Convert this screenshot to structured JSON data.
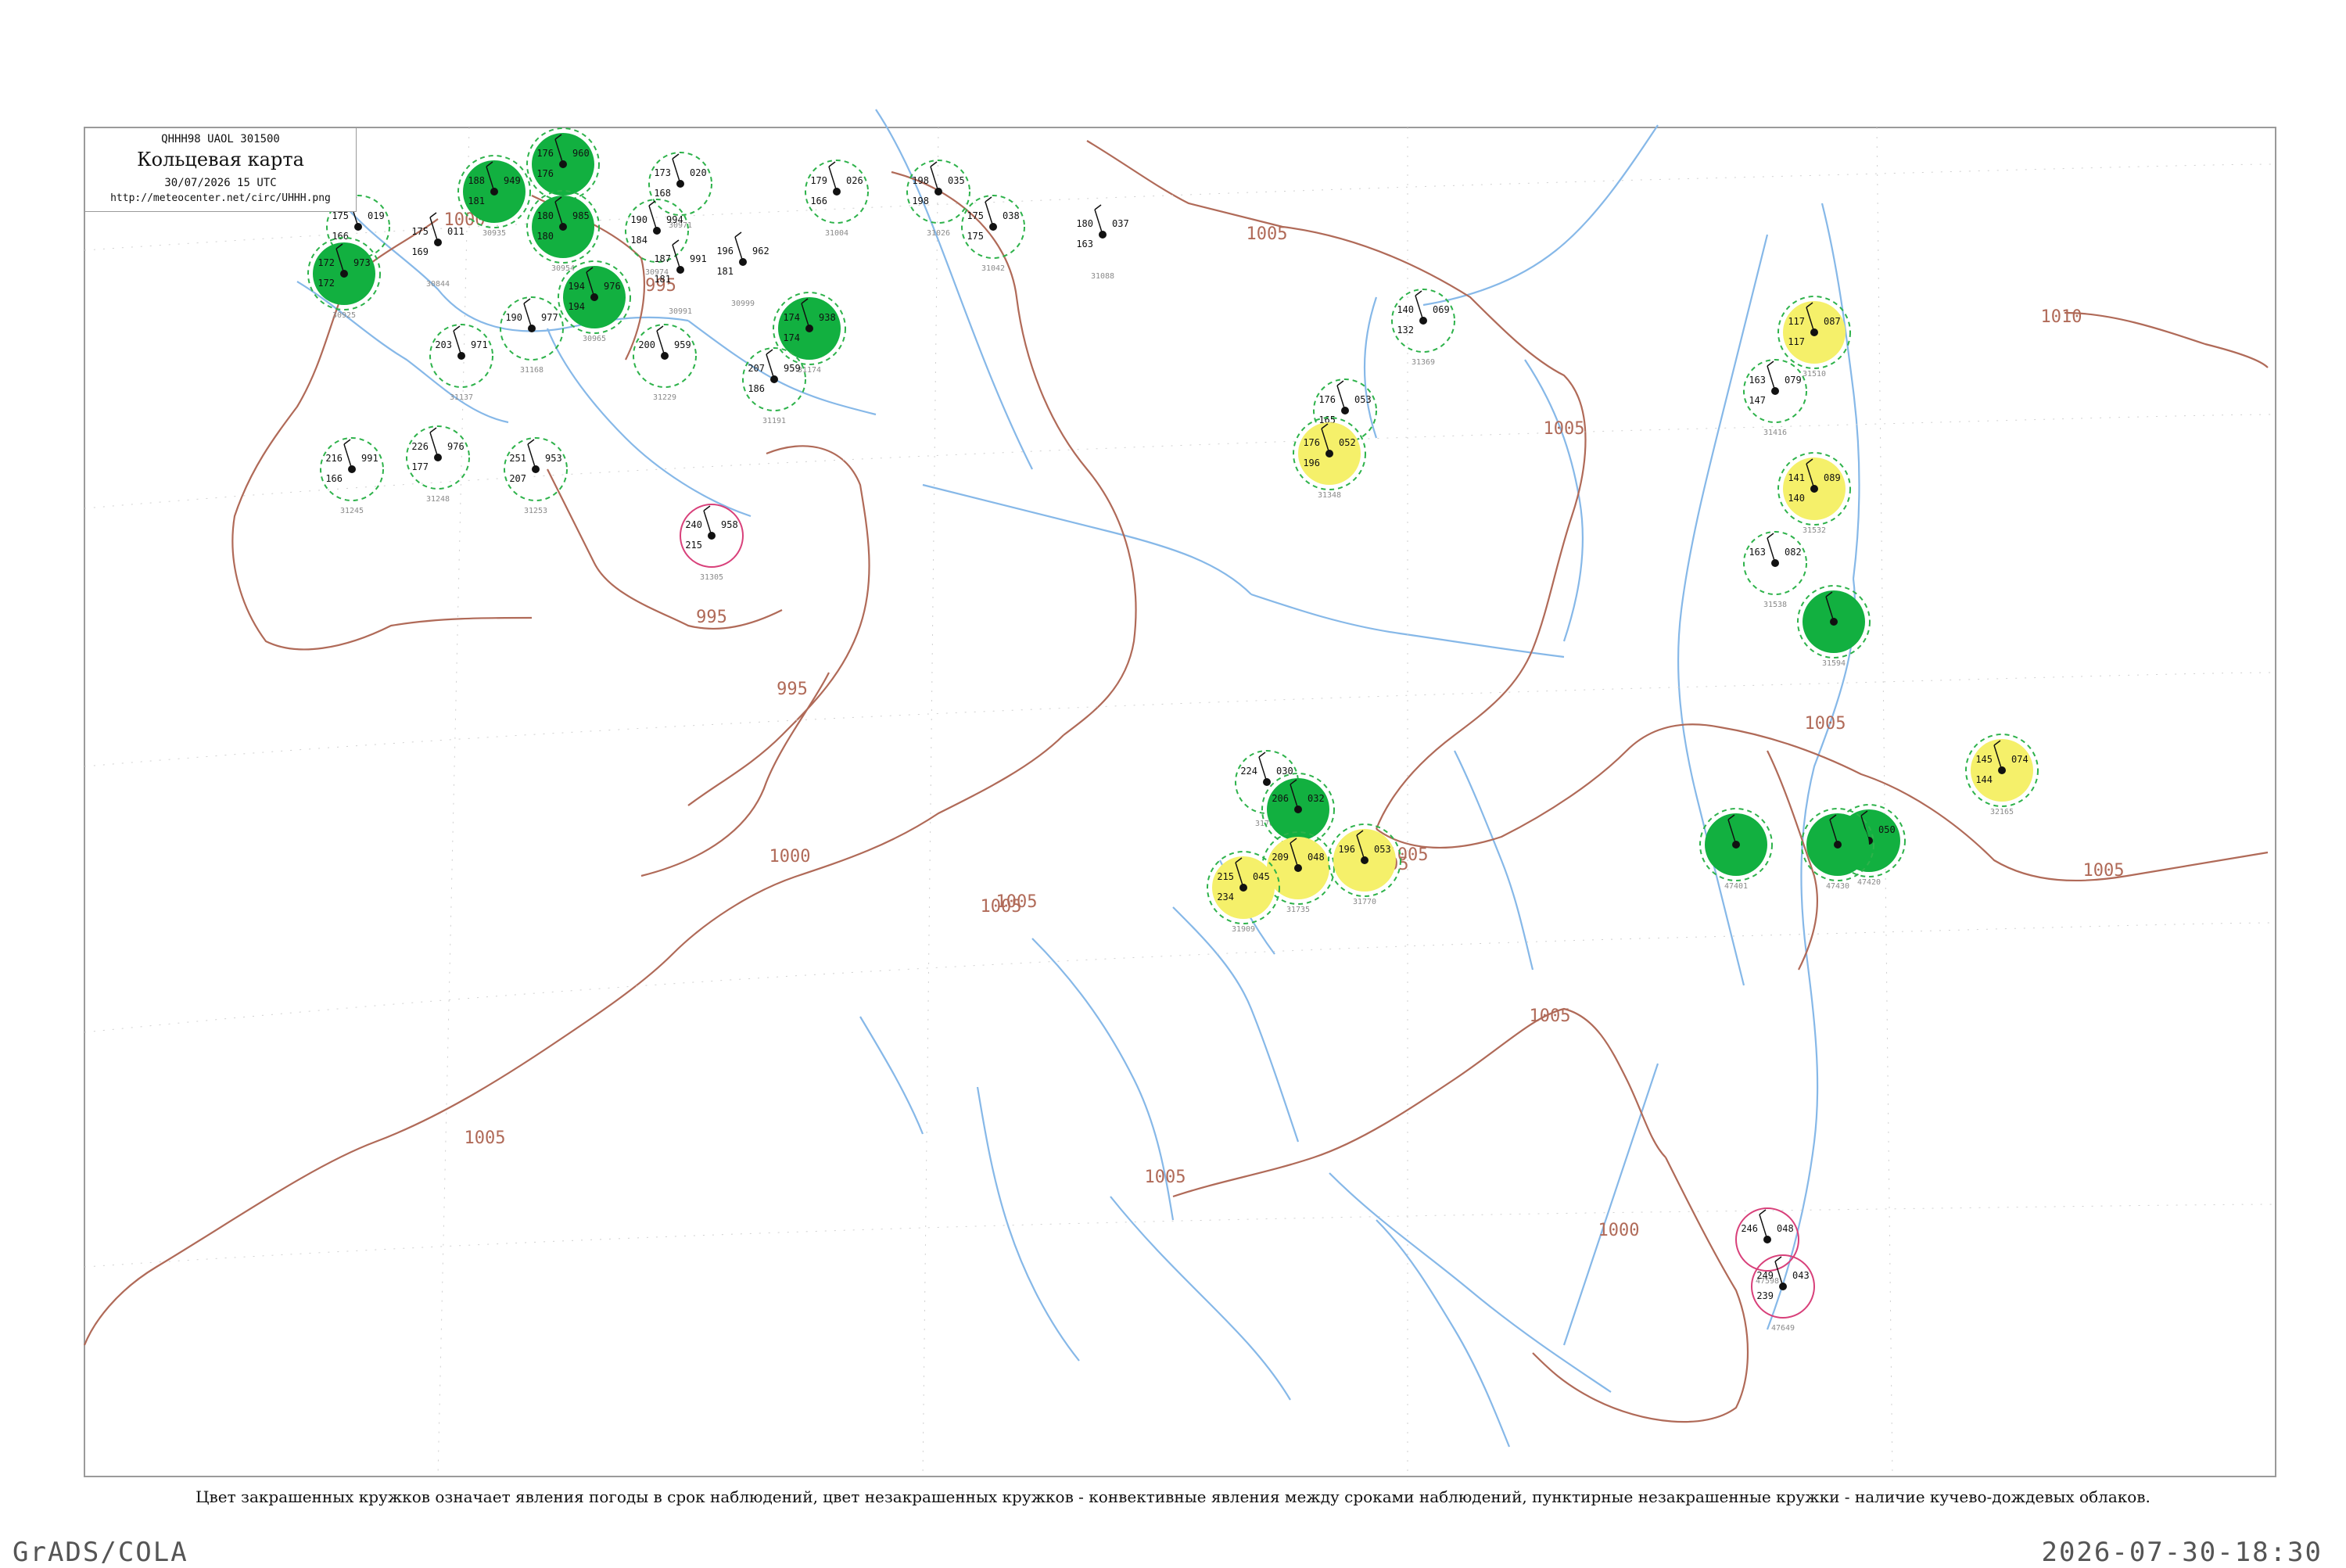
{
  "header": {
    "code": "QHHH98  UAOL  301500",
    "title": "Кольцевая карта",
    "datetime": "30/07/2026 15 UTC",
    "url": "http://meteocenter.net/circ/UHHH.png"
  },
  "caption": "Цвет закрашенных кружков означает явления погоды в срок наблюдений, цвет незакрашенных кружков - конвективные явления между сроками наблюдений, пунктирные незакрашенные кружки - наличие кучево-дождевых облаков.",
  "footer": {
    "left": "GrADS/COLA",
    "right": "2026-07-30-18:30"
  },
  "colors": {
    "isobar": "#b06a58",
    "river": "#86b8e8",
    "green_fill": "#12b040",
    "yellow_fill": "#f5f06a",
    "cb_dashed": "#2db24a",
    "convective_ring": "#d8407a",
    "text": "#111111",
    "index": "#8a8a8a"
  },
  "isobar_labels": [
    "1000",
    "995",
    "995",
    "995",
    "1000",
    "1005",
    "1005",
    "1005",
    "1005",
    "1005",
    "1005",
    "1005",
    "1005",
    "1005",
    "1005",
    "1010",
    "1000",
    "1005"
  ],
  "stations": [
    {
      "id": "30823",
      "t": "175",
      "p": "019",
      "dp": "166",
      "ring": "dashed"
    },
    {
      "id": "30844",
      "t": "175",
      "p": "011",
      "dp": "169",
      "ring": "none"
    },
    {
      "id": "30925",
      "t": "172",
      "p": "973",
      "dp": "172",
      "ring": "filled-green"
    },
    {
      "id": "30935",
      "t": "188",
      "p": "949",
      "dp": "181",
      "ring": "filled-green"
    },
    {
      "id": "30949",
      "t": "176",
      "p": "960",
      "dp": "176",
      "ring": "filled-green"
    },
    {
      "id": "30954",
      "t": "180",
      "p": "985",
      "dp": "180",
      "ring": "filled-green"
    },
    {
      "id": "30965",
      "t": "194",
      "p": "976",
      "dp": "194",
      "ring": "filled-green"
    },
    {
      "id": "30971",
      "t": "173",
      "p": "020",
      "dp": "168",
      "ring": "dashed"
    },
    {
      "id": "30974",
      "t": "190",
      "p": "994",
      "dp": "184",
      "ring": "dashed"
    },
    {
      "id": "30991",
      "t": "187",
      "p": "991",
      "dp": "181",
      "ring": "none"
    },
    {
      "id": "30999",
      "t": "196",
      "p": "962",
      "dp": "181",
      "ring": "none"
    },
    {
      "id": "31004",
      "t": "179",
      "p": "026",
      "dp": "166",
      "ring": "dashed"
    },
    {
      "id": "31026",
      "t": "198",
      "p": "035",
      "dp": "198",
      "ring": "dashed"
    },
    {
      "id": "31042",
      "t": "175",
      "p": "038",
      "dp": "175",
      "ring": "dashed"
    },
    {
      "id": "31088",
      "t": "180",
      "p": "037",
      "dp": "163",
      "ring": "none"
    },
    {
      "id": "31137",
      "t": "203",
      "p": "971",
      "dp": "",
      "ring": "dashed"
    },
    {
      "id": "31168",
      "t": "190",
      "p": "977",
      "dp": "",
      "ring": "dashed"
    },
    {
      "id": "31174",
      "t": "174",
      "p": "938",
      "dp": "174",
      "ring": "filled-green"
    },
    {
      "id": "31191",
      "t": "207",
      "p": "959",
      "dp": "186",
      "ring": "dashed"
    },
    {
      "id": "31229",
      "t": "200",
      "p": "959",
      "dp": "",
      "ring": "dashed"
    },
    {
      "id": "31245",
      "t": "216",
      "p": "991",
      "dp": "166",
      "ring": "dashed"
    },
    {
      "id": "31248",
      "t": "226",
      "p": "976",
      "dp": "177",
      "ring": "dashed"
    },
    {
      "id": "31253",
      "t": "251",
      "p": "953",
      "dp": "207",
      "ring": "dashed"
    },
    {
      "id": "31305",
      "t": "240",
      "p": "958",
      "dp": "215",
      "ring": "convective"
    },
    {
      "id": "31329",
      "t": "176",
      "p": "053",
      "dp": "165",
      "ring": "dashed"
    },
    {
      "id": "31348",
      "t": "176",
      "p": "052",
      "dp": "196",
      "ring": "filled-yellow"
    },
    {
      "id": "31369",
      "t": "140",
      "p": "069",
      "dp": "132",
      "ring": "dashed"
    },
    {
      "id": "31416",
      "t": "163",
      "p": "079",
      "dp": "147",
      "ring": "dashed"
    },
    {
      "id": "31510",
      "t": "117",
      "p": "087",
      "dp": "117",
      "ring": "filled-yellow"
    },
    {
      "id": "31532",
      "t": "141",
      "p": "089",
      "dp": "140",
      "ring": "filled-yellow"
    },
    {
      "id": "31538",
      "t": "163",
      "p": "082",
      "dp": "",
      "ring": "dashed"
    },
    {
      "id": "31594",
      "t": "",
      "p": "",
      "dp": "",
      "ring": "filled-green"
    },
    {
      "id": "31707",
      "t": "224",
      "p": "030",
      "dp": "",
      "ring": "dashed"
    },
    {
      "id": "31725",
      "t": "206",
      "p": "032",
      "dp": "",
      "ring": "filled-green"
    },
    {
      "id": "31735",
      "t": "209",
      "p": "048",
      "dp": "",
      "ring": "filled-yellow"
    },
    {
      "id": "31770",
      "t": "196",
      "p": "053",
      "dp": "",
      "ring": "filled-yellow"
    },
    {
      "id": "31909",
      "t": "215",
      "p": "045",
      "dp": "234",
      "ring": "filled-yellow"
    },
    {
      "id": "32165",
      "t": "145",
      "p": "074",
      "dp": "144",
      "ring": "filled-yellow"
    },
    {
      "id": "47401",
      "t": "",
      "p": "",
      "dp": "",
      "ring": "filled-green"
    },
    {
      "id": "47420",
      "t": "",
      "p": "050",
      "dp": "",
      "ring": "filled-green"
    },
    {
      "id": "47430",
      "t": "",
      "p": "",
      "dp": "",
      "ring": "filled-green"
    },
    {
      "id": "47598",
      "t": "246",
      "p": "048",
      "dp": "",
      "ring": "convective"
    },
    {
      "id": "47649",
      "t": "249",
      "p": "043",
      "dp": "239",
      "ring": "convective"
    }
  ]
}
